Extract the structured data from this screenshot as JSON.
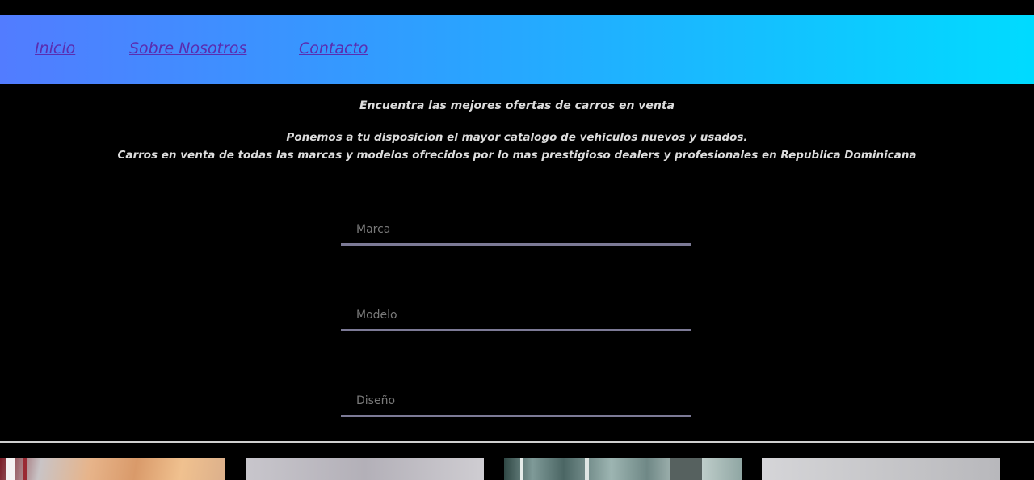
{
  "nav": {
    "items": [
      {
        "label": "Inicio"
      },
      {
        "label": "Sobre Nosotros"
      },
      {
        "label": "Contacto"
      }
    ]
  },
  "hero": {
    "headline": "Encuentra las mejores ofertas de carros en venta",
    "description_line1": "Ponemos a tu disposicion el mayor catalogo de vehiculos nuevos y usados.",
    "description_line2": "Carros en venta de todas las marcas y modelos ofrecidos por lo mas prestigioso dealers y profesionales en Republica Dominicana"
  },
  "search_form": {
    "fields": [
      {
        "placeholder": "Marca",
        "value": ""
      },
      {
        "placeholder": "Modelo",
        "value": ""
      },
      {
        "placeholder": "Diseño",
        "value": ""
      }
    ]
  },
  "colors": {
    "background": "#000000",
    "nav_gradient_start": "#527cff",
    "nav_gradient_end": "#00dbff",
    "nav_link": "#5a2db0",
    "text": "#dcdcdc",
    "field_underline": "#7c7a96"
  },
  "gallery": {
    "cards": [
      {
        "image": "car-photo-1"
      },
      {
        "image": "car-photo-2"
      },
      {
        "image": "car-photo-3"
      },
      {
        "image": "car-photo-4"
      }
    ]
  }
}
